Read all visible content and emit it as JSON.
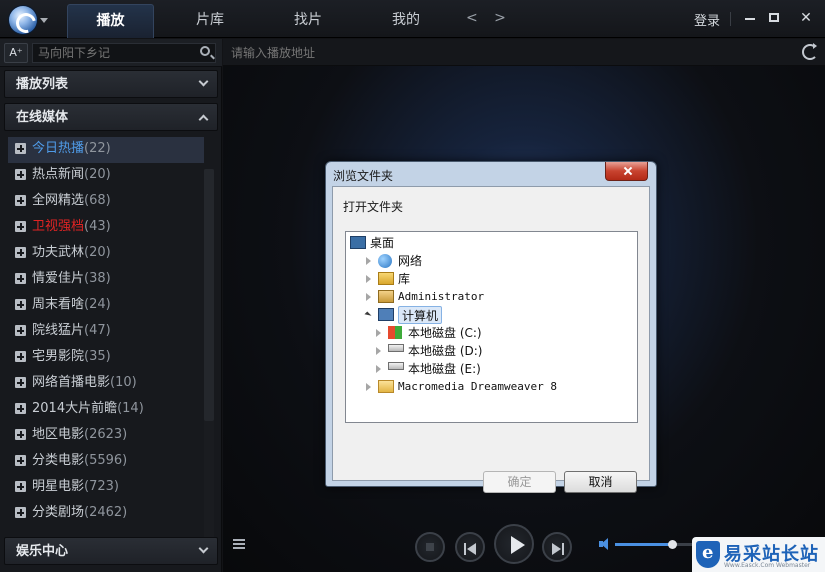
{
  "header": {
    "tabs": [
      "播放",
      "片库",
      "找片",
      "我的"
    ],
    "nav_arrows": "< >",
    "login": "登录",
    "window_controls": [
      "minimize-icon",
      "maximize-icon",
      "close-icon"
    ]
  },
  "sidebar": {
    "font_button": "A⁺",
    "search_placeholder": "马向阳下乡记",
    "sections": {
      "playlist": "播放列表",
      "online_media": "在线媒体",
      "entertainment": "娱乐中心"
    },
    "items": [
      {
        "label": "今日热播",
        "count": "(22)",
        "state": "selected"
      },
      {
        "label": "热点新闻",
        "count": "(20)",
        "state": ""
      },
      {
        "label": "全网精选",
        "count": "(68)",
        "state": ""
      },
      {
        "label": "卫视强档",
        "count": "(43)",
        "state": "hot"
      },
      {
        "label": "功夫武林",
        "count": "(20)",
        "state": ""
      },
      {
        "label": "情爱佳片",
        "count": "(38)",
        "state": ""
      },
      {
        "label": "周末看啥",
        "count": "(24)",
        "state": ""
      },
      {
        "label": "院线猛片",
        "count": "(47)",
        "state": ""
      },
      {
        "label": "宅男影院",
        "count": "(35)",
        "state": ""
      },
      {
        "label": "网络首播电影",
        "count": "(10)",
        "state": ""
      },
      {
        "label": "2014大片前瞻",
        "count": "(14)",
        "state": ""
      },
      {
        "label": "地区电影",
        "count": "(2623)",
        "state": ""
      },
      {
        "label": "分类电影",
        "count": "(5596)",
        "state": ""
      },
      {
        "label": "明星电影",
        "count": "(723)",
        "state": ""
      },
      {
        "label": "分类剧场",
        "count": "(2462)",
        "state": ""
      }
    ]
  },
  "player": {
    "address_placeholder": "请输入播放地址",
    "volume": 0.55
  },
  "dialog": {
    "title": "浏览文件夹",
    "prompt": "打开文件夹",
    "tree": [
      {
        "label": "桌面",
        "icon": "desktop-icon",
        "level": 0,
        "expander": "none",
        "mono": false
      },
      {
        "label": "网络",
        "icon": "network-icon",
        "level": 1,
        "expander": "closed",
        "mono": false
      },
      {
        "label": "库",
        "icon": "library-icon",
        "level": 1,
        "expander": "closed",
        "mono": false
      },
      {
        "label": "Administrator",
        "icon": "user-folder-icon",
        "level": 1,
        "expander": "closed",
        "mono": true
      },
      {
        "label": "计算机",
        "icon": "computer-icon",
        "level": 1,
        "expander": "open",
        "mono": false,
        "selected": true
      },
      {
        "label": "本地磁盘 (C:)",
        "icon": "system-drive-icon",
        "level": 2,
        "expander": "closed",
        "mono": false
      },
      {
        "label": "本地磁盘 (D:)",
        "icon": "drive-icon",
        "level": 2,
        "expander": "closed",
        "mono": false
      },
      {
        "label": "本地磁盘 (E:)",
        "icon": "drive-icon",
        "level": 2,
        "expander": "closed",
        "mono": false
      },
      {
        "label": "Macromedia Dreamweaver 8",
        "icon": "folder-icon",
        "level": 1,
        "expander": "closed",
        "mono": true
      }
    ],
    "ok_label": "确定",
    "cancel_label": "取消"
  },
  "watermark": {
    "text": "易采站长站",
    "sub": "Www.Easck.Com Webmaster"
  }
}
